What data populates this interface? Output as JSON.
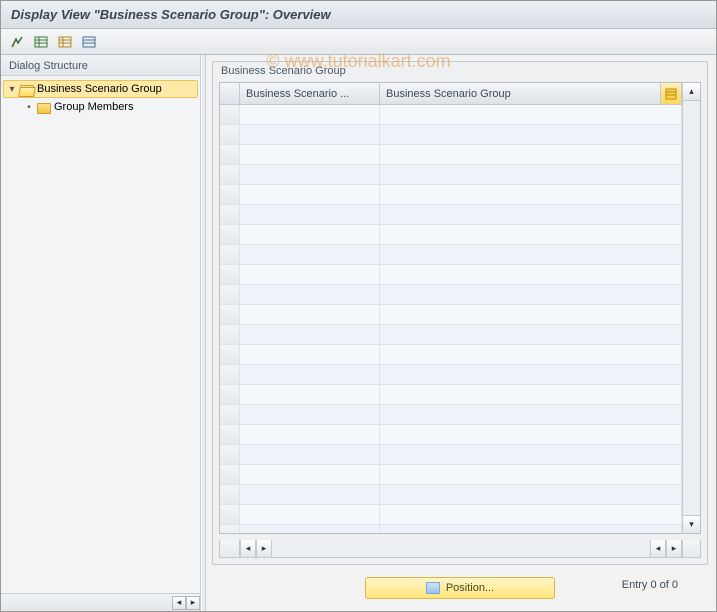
{
  "title": "Display View \"Business Scenario Group\": Overview",
  "watermark": "© www.tutorialkart.com",
  "sidebar": {
    "header": "Dialog Structure",
    "items": [
      {
        "label": "Business Scenario Group",
        "level": 0,
        "expanded": true,
        "open": true,
        "selected": true
      },
      {
        "label": "Group Members",
        "level": 1,
        "expanded": false,
        "open": false,
        "selected": false
      }
    ]
  },
  "group": {
    "title": "Business Scenario Group",
    "columns": {
      "col1": "Business Scenario ...",
      "col2": "Business Scenario Group"
    },
    "row_count": 22
  },
  "footer": {
    "position_label": "Position...",
    "entry_text": "Entry 0 of 0"
  }
}
